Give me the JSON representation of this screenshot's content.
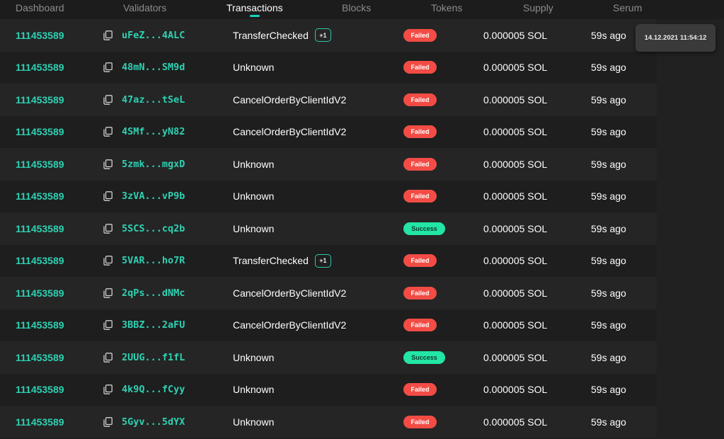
{
  "nav": {
    "items": [
      {
        "label": "Dashboard",
        "active": false
      },
      {
        "label": "Validators",
        "active": false
      },
      {
        "label": "Transactions",
        "active": true
      },
      {
        "label": "Blocks",
        "active": false
      },
      {
        "label": "Tokens",
        "active": false
      },
      {
        "label": "Supply",
        "active": false
      },
      {
        "label": "Serum",
        "active": false
      }
    ]
  },
  "tooltip": {
    "text": "14.12.2021 11:54:12"
  },
  "copy_icon": "copy-icon",
  "colors": {
    "accent": "#2ed1b3",
    "failed": "#f24c45",
    "success": "#22e5a6",
    "background": "#1c1c1c"
  },
  "transactions": [
    {
      "block": "111453589",
      "signature": "uFeZ...4ALC",
      "instruction": "TransferChecked",
      "extra": "+1",
      "status": "Failed",
      "fee": "0.000005 SOL",
      "age": "59s ago"
    },
    {
      "block": "111453589",
      "signature": "48mN...SM9d",
      "instruction": "Unknown",
      "extra": null,
      "status": "Failed",
      "fee": "0.000005 SOL",
      "age": "59s ago"
    },
    {
      "block": "111453589",
      "signature": "47az...tSeL",
      "instruction": "CancelOrderByClientIdV2",
      "extra": null,
      "status": "Failed",
      "fee": "0.000005 SOL",
      "age": "59s ago"
    },
    {
      "block": "111453589",
      "signature": "4SMf...yN82",
      "instruction": "CancelOrderByClientIdV2",
      "extra": null,
      "status": "Failed",
      "fee": "0.000005 SOL",
      "age": "59s ago"
    },
    {
      "block": "111453589",
      "signature": "5zmk...mgxD",
      "instruction": "Unknown",
      "extra": null,
      "status": "Failed",
      "fee": "0.000005 SOL",
      "age": "59s ago"
    },
    {
      "block": "111453589",
      "signature": "3zVA...vP9b",
      "instruction": "Unknown",
      "extra": null,
      "status": "Failed",
      "fee": "0.000005 SOL",
      "age": "59s ago"
    },
    {
      "block": "111453589",
      "signature": "5SCS...cq2b",
      "instruction": "Unknown",
      "extra": null,
      "status": "Success",
      "fee": "0.000005 SOL",
      "age": "59s ago"
    },
    {
      "block": "111453589",
      "signature": "5VAR...ho7R",
      "instruction": "TransferChecked",
      "extra": "+1",
      "status": "Failed",
      "fee": "0.000005 SOL",
      "age": "59s ago"
    },
    {
      "block": "111453589",
      "signature": "2qPs...dNMc",
      "instruction": "CancelOrderByClientIdV2",
      "extra": null,
      "status": "Failed",
      "fee": "0.000005 SOL",
      "age": "59s ago"
    },
    {
      "block": "111453589",
      "signature": "3BBZ...2aFU",
      "instruction": "CancelOrderByClientIdV2",
      "extra": null,
      "status": "Failed",
      "fee": "0.000005 SOL",
      "age": "59s ago"
    },
    {
      "block": "111453589",
      "signature": "2UUG...f1fL",
      "instruction": "Unknown",
      "extra": null,
      "status": "Success",
      "fee": "0.000005 SOL",
      "age": "59s ago"
    },
    {
      "block": "111453589",
      "signature": "4k9Q...fCyy",
      "instruction": "Unknown",
      "extra": null,
      "status": "Failed",
      "fee": "0.000005 SOL",
      "age": "59s ago"
    },
    {
      "block": "111453589",
      "signature": "5Gyv...5dYX",
      "instruction": "Unknown",
      "extra": null,
      "status": "Failed",
      "fee": "0.000005 SOL",
      "age": "59s ago"
    }
  ]
}
